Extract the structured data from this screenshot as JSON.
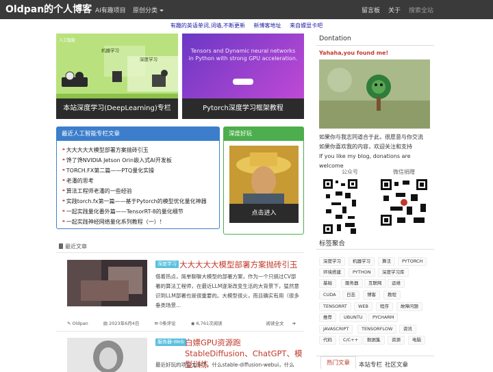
{
  "nav": {
    "brand": "Oldpan的个人博客",
    "items": [
      "AI有趣项目",
      "原创分类"
    ],
    "right_items": [
      "留言板",
      "关于"
    ],
    "search_placeholder": "搜索全站"
  },
  "notice": [
    "有趣的英语单词,词墙,不断更新",
    "新博客地址",
    "来自嫖显卡吧"
  ],
  "banners": [
    {
      "caption": "本站深度学习(DeepLearning)专栏",
      "labels": [
        "人工智能",
        "机器学习",
        "深度学习"
      ]
    },
    {
      "caption": "Pytorch深度学习框架教程",
      "headline": "Tensors and Dynamic neural networks in Python with strong GPU acceleration."
    }
  ],
  "recent_box": {
    "title": "最近人工智能专栏文章",
    "items": [
      "大大大大大模型部署方案抛砖引玉",
      "馋了馋NVIDIA Jetson Orin嵌入式AI开发板",
      "TORCH.FX第二篇——PTQ量化实操",
      "老潘的思考",
      "算法工程师老潘的一些经验",
      "实践torch.fx第一篇——基于Pytorch的模型优化量化神器",
      "一起实践量化番外篇——TensorRT-8的量化细节",
      "一起实践神经网络量化系列教程（一）！"
    ]
  },
  "dl_box": {
    "title": "深度好玩",
    "button": "点击进入"
  },
  "latest": {
    "heading": "最近文章",
    "articles": [
      {
        "tag": "深度学习",
        "title": "大大大大大模型部署方案抛砖引玉",
        "body": "借着热点，简单聊聊大模型的部署方案，作为一个只搞过CV部署的算法工程师，在最近LLM逐渐改变生活的大背景下，猛然意识到LLM部署也是很重要的。大模型很火，而且确实有用（很多垂类场景...",
        "author": "Oldpan",
        "date": "2023年6月4日",
        "comments": "0条评论",
        "views": "6,761次阅读",
        "more": "阅读全文"
      },
      {
        "tag": "服务器-Web",
        "title": "白嫖GPU资源跑StableDiffusion、ChatGPT、模型训练",
        "body": "最近好玩的项目太多了，什么stable-diffusion-webui，什么"
      }
    ]
  },
  "sidebar": {
    "donation_title": "Dontation",
    "found": "Yahaha,you found me!",
    "text": [
      "如果你与我志同道合于此，很愿意与你交流",
      "如果你喜欢我的内容，欢迎关注和支持",
      "If you like my blog, donations are welcome"
    ],
    "qr_labels": [
      "公众号",
      "微信捐赠"
    ],
    "tags_title": "标签聚合",
    "tags": [
      "深度学习",
      "机器学习",
      "算法",
      "PYTORCH",
      "环境搭建",
      "PYTHON",
      "深度学习库",
      "基础",
      "服务器",
      "互联网",
      "运维",
      "CUDA",
      "日志",
      "博客",
      "教程",
      "TENSORRT",
      "WEB",
      "程序",
      "故障问题",
      "推荐",
      "UBUNTU",
      "PYCHARM",
      "JAVASCRIPT",
      "TENSORFLOW",
      "资讯",
      "代码",
      "C/C++",
      "数据集",
      "资源",
      "电脑"
    ],
    "tabs": [
      "热门文章",
      "本站专栏",
      "社区文章"
    ]
  },
  "colors": {
    "nav_bg": "#3a3a3a",
    "blue": "#3c7ecb",
    "green": "#4cae4c",
    "red": "#c0392b",
    "tag_bg": "#5bc0de"
  }
}
